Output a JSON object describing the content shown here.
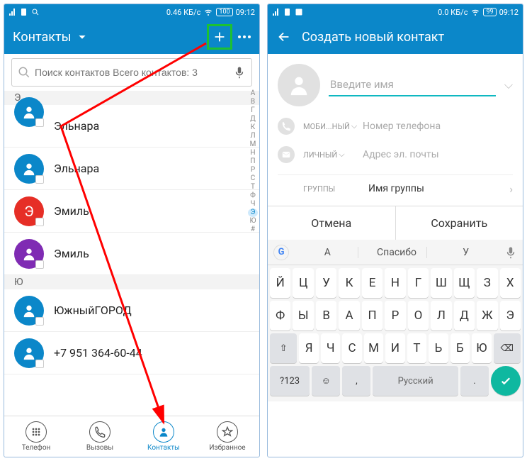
{
  "left": {
    "statusbar": {
      "data": "0.46 КБ/с",
      "battery": "100",
      "time": "09:12"
    },
    "titlebar": {
      "title": "Контакты"
    },
    "search": {
      "placeholder": "Поиск контактов Всего контактов: 3"
    },
    "sections": [
      {
        "letter": "Э",
        "rows": [
          {
            "name": "Эльнара",
            "color": "#0b87c9"
          },
          {
            "name": "Эльнара",
            "color": "#0b87c9"
          },
          {
            "name": "Эмиль",
            "color": "#e62e26",
            "textBadge": "Э"
          },
          {
            "name": "Эмиль",
            "color": "#7f2bb3"
          }
        ]
      },
      {
        "letter": "Ю",
        "rows": [
          {
            "name": "ЮжныйГОРОД",
            "color": "#0b87c9"
          },
          {
            "name": "+7 951 364-60-44",
            "color": "#0b87c9"
          }
        ]
      }
    ],
    "alpha_index": [
      "A",
      "B",
      "Г",
      "Д",
      "К",
      "Л",
      "М",
      "Н",
      "П",
      "Р",
      "С",
      "Т",
      "Ф",
      "Ч",
      "Э",
      "Ю",
      "#"
    ],
    "alpha_highlight": "Э",
    "nav": [
      {
        "label": "Телефон"
      },
      {
        "label": "Вызовы"
      },
      {
        "label": "Контакты",
        "active": true
      },
      {
        "label": "Избранное"
      }
    ]
  },
  "right": {
    "statusbar": {
      "data": "0.0 КБ/с",
      "battery": "99",
      "time": "09:12"
    },
    "titlebar": {
      "title": "Создать новый контакт"
    },
    "form": {
      "name_placeholder": "Введите имя",
      "phone_type": "МОБИ...НЫЙ",
      "phone_placeholder": "Номер телефона",
      "email_type": "ЛИЧНЫЙ",
      "email_placeholder": "Адрес эл. почты",
      "group_label": "ГРУППЫ",
      "group_value": "Имя группы"
    },
    "actions": {
      "cancel": "Отмена",
      "save": "Сохранить"
    },
    "suggestions": [
      "А",
      "Спасибо",
      "У"
    ],
    "keyboard": {
      "row1": [
        "Й",
        "Ц",
        "У",
        "К",
        "Е",
        "Н",
        "Г",
        "Ш",
        "Щ",
        "З",
        "Х"
      ],
      "row2": [
        "Ф",
        "Ы",
        "В",
        "А",
        "П",
        "Р",
        "О",
        "Л",
        "Д",
        "Ж",
        "Э"
      ],
      "row3_shift": "⇧",
      "row3": [
        "Я",
        "Ч",
        "С",
        "М",
        "И",
        "Т",
        "Ь",
        "Б",
        "Ю"
      ],
      "row3_bksp": "⌫",
      "row4": {
        "num": "?123",
        "emoji": "☺",
        "comma": ",",
        "space": "Русский",
        "period": "."
      }
    }
  }
}
